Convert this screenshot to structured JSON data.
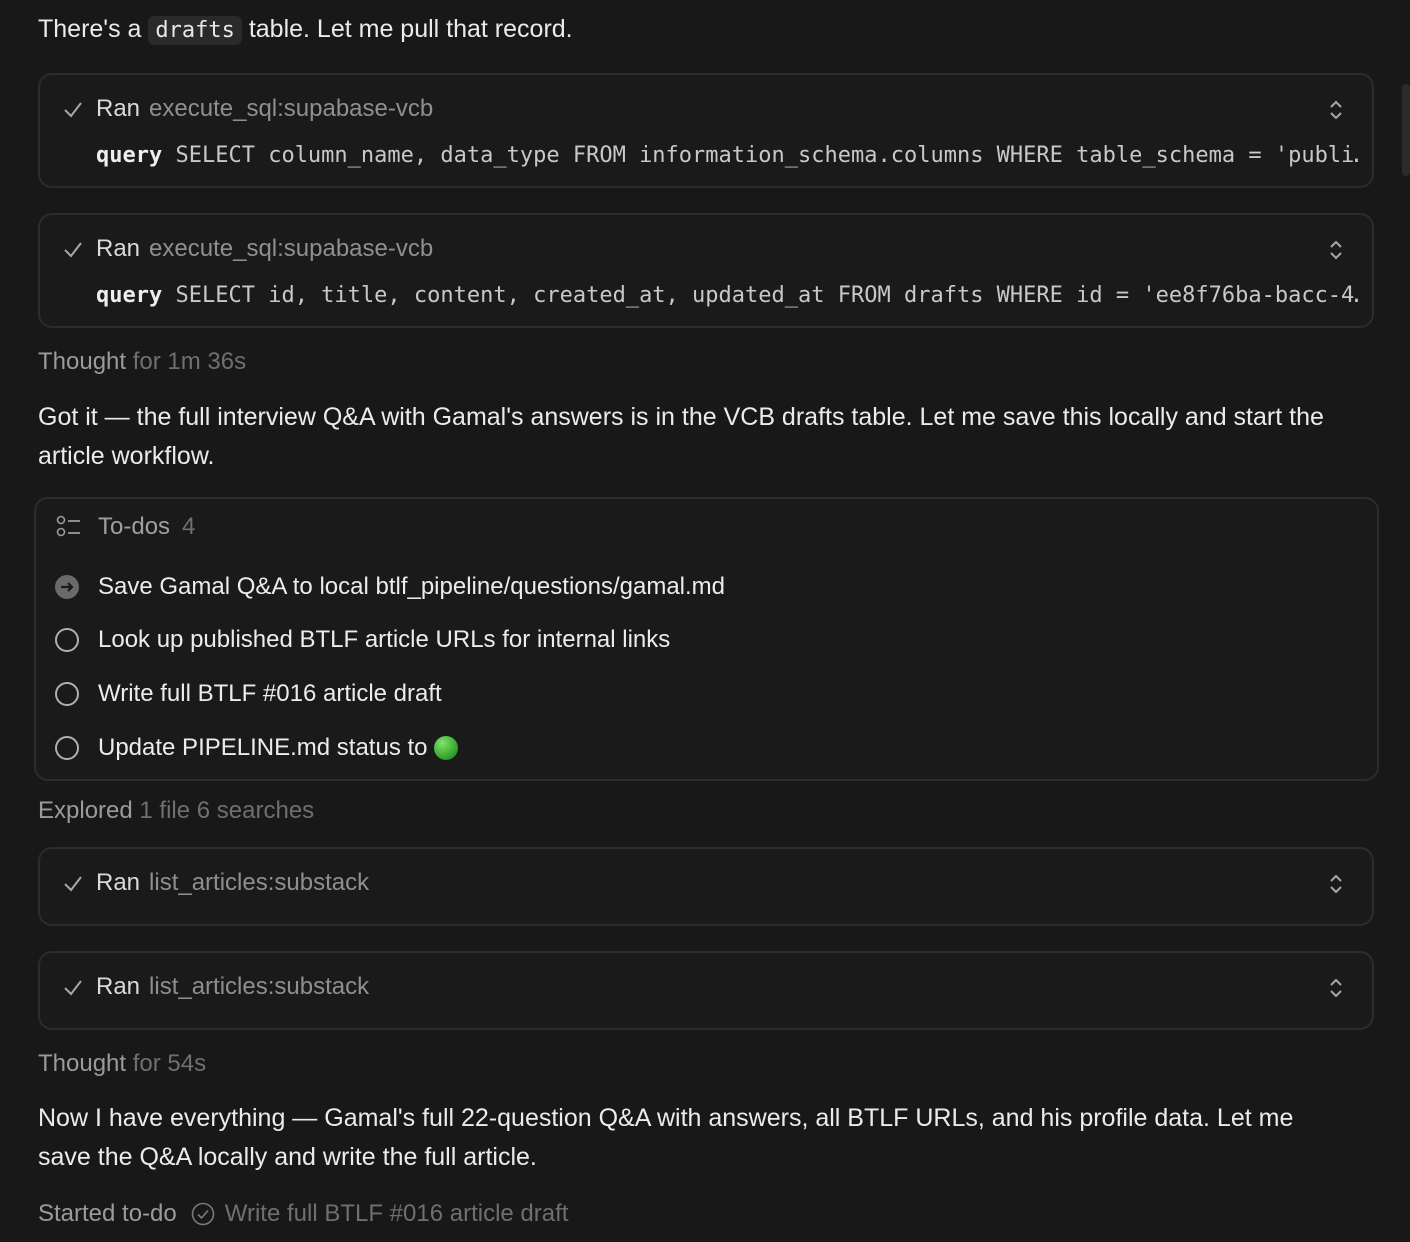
{
  "intro": {
    "before": "There's a ",
    "code": "drafts",
    "after": " table. Let me pull that record."
  },
  "tool_calls": [
    {
      "status": "Ran",
      "tool": "execute_sql:supabase-vcb",
      "param_label": "query",
      "param_value": "SELECT column_name, data_type FROM information_schema.columns WHERE table_schema = 'publi…"
    },
    {
      "status": "Ran",
      "tool": "execute_sql:supabase-vcb",
      "param_label": "query",
      "param_value": "SELECT id, title, content, created_at, updated_at FROM drafts WHERE id = 'ee8f76ba-bacc-4…"
    },
    {
      "status": "Ran",
      "tool": "list_articles:substack"
    },
    {
      "status": "Ran",
      "tool": "list_articles:substack"
    }
  ],
  "thought1": {
    "label": "Thought",
    "duration": "for 1m 36s"
  },
  "message1": "Got it — the full interview Q&A with Gamal's answers is in the VCB drafts table. Let me save this locally and start the article workflow.",
  "todos": {
    "title": "To-dos",
    "count": "4",
    "items": [
      {
        "label": "Save Gamal Q&A to local btlf_pipeline/questions/gamal.md",
        "status": "in-progress"
      },
      {
        "label": "Look up published BTLF article URLs for internal links",
        "status": "pending"
      },
      {
        "label": "Write full BTLF #016 article draft",
        "status": "pending"
      },
      {
        "label": "Update PIPELINE.md status to",
        "status": "pending",
        "emoji": "green-circle"
      }
    ]
  },
  "explored": {
    "label": "Explored",
    "detail": "1 file 6 searches"
  },
  "thought2": {
    "label": "Thought",
    "duration": "for 54s"
  },
  "message2": "Now I have everything — Gamal's full 22-question Q&A with answers, all BTLF URLs, and his profile data. Let me save the Q&A locally and write the full article.",
  "started": {
    "label": "Started to-do",
    "task": "Write full BTLF #016 article draft"
  },
  "colors": {
    "background": "#181818",
    "card_border": "#2c2c2c",
    "muted": "#8f8f8f",
    "status_green": "#2f9d28"
  }
}
